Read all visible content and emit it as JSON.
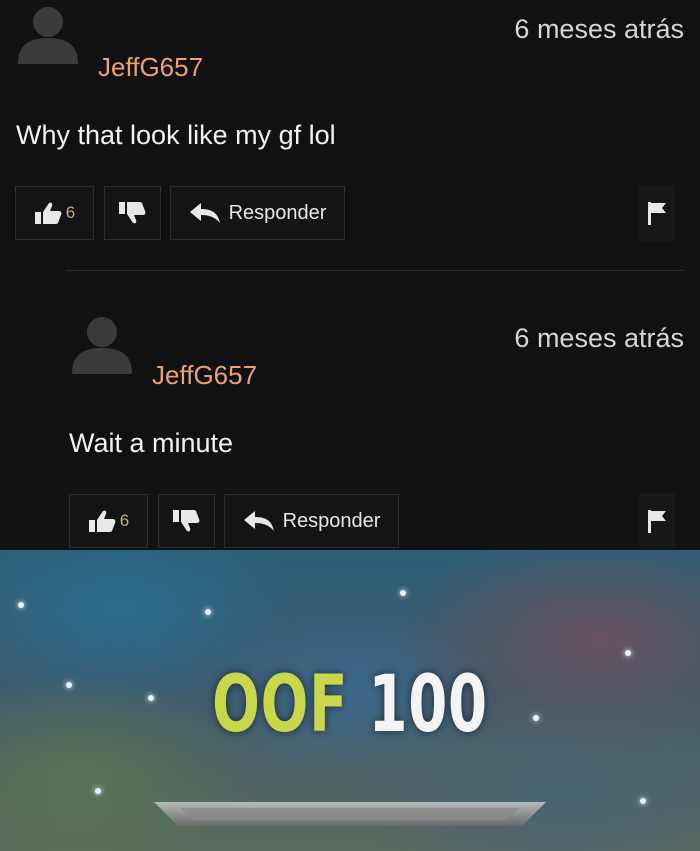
{
  "comments": [
    {
      "username": "JeffG657",
      "timestamp": "6 meses atrás",
      "text": "Why that look like my gf lol",
      "like_count": "6",
      "reply_label": "Responder",
      "icons": [
        "avatar-icon",
        "thumbs-up-icon",
        "thumbs-down-icon",
        "reply-arrow-icon",
        "flag-icon"
      ]
    },
    {
      "username": "JeffG657",
      "timestamp": "6 meses atrás",
      "text": "Wait a minute",
      "like_count": "6",
      "reply_label": "Responder",
      "icons": [
        "avatar-icon",
        "thumbs-up-icon",
        "thumbs-down-icon",
        "reply-arrow-icon",
        "flag-icon"
      ]
    }
  ],
  "banner": {
    "word1": "OOF",
    "word2": "100",
    "colors": {
      "word1": "#c8d84a",
      "word2": "#f4f4f4"
    }
  }
}
